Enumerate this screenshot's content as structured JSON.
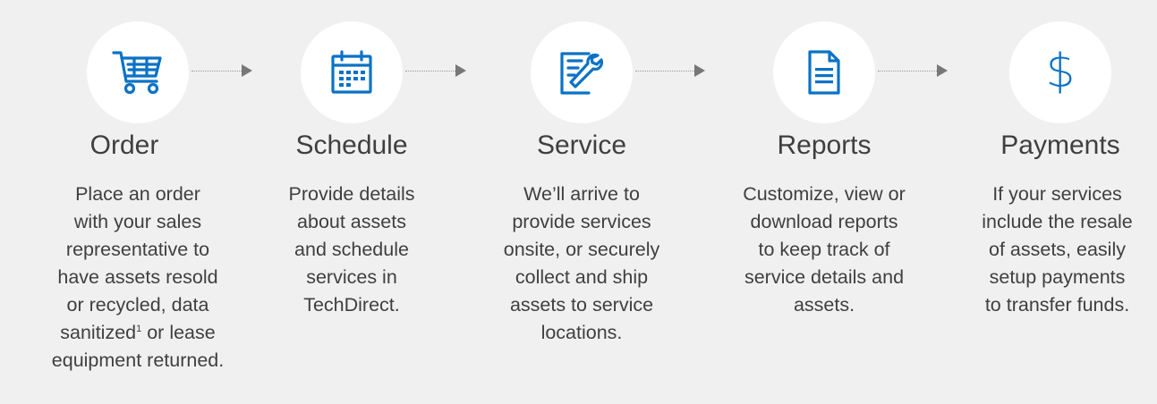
{
  "accent_color": "#0a72c6",
  "steps": [
    {
      "icon": "shopping-cart-icon",
      "title": "Order",
      "lines": [
        "Place an order",
        "with your sales",
        "representative to",
        "have assets resold",
        "or recycled, data"
      ],
      "line_sanitized_a": "sanitized",
      "line_sanitized_sup": "1",
      "line_sanitized_b": " or lease",
      "last_line": "equipment returned."
    },
    {
      "icon": "calendar-icon",
      "title": "Schedule",
      "lines": [
        "Provide details",
        "about assets",
        "and schedule",
        "services in",
        "TechDirect."
      ]
    },
    {
      "icon": "wrench-service-icon",
      "title": "Service",
      "lines": [
        "We’ll arrive to",
        "provide services",
        "onsite, or securely",
        "collect and ship",
        "assets to service",
        "locations."
      ]
    },
    {
      "icon": "document-icon",
      "title": "Reports",
      "lines": [
        "Customize, view or",
        "download reports",
        "to keep track of",
        "service details and",
        "assets."
      ]
    },
    {
      "icon": "dollar-icon",
      "icon_text": "$",
      "title": "Payments",
      "lines": [
        "If your services",
        "include the resale",
        "of assets, easily",
        "setup payments",
        "to transfer funds."
      ]
    }
  ]
}
